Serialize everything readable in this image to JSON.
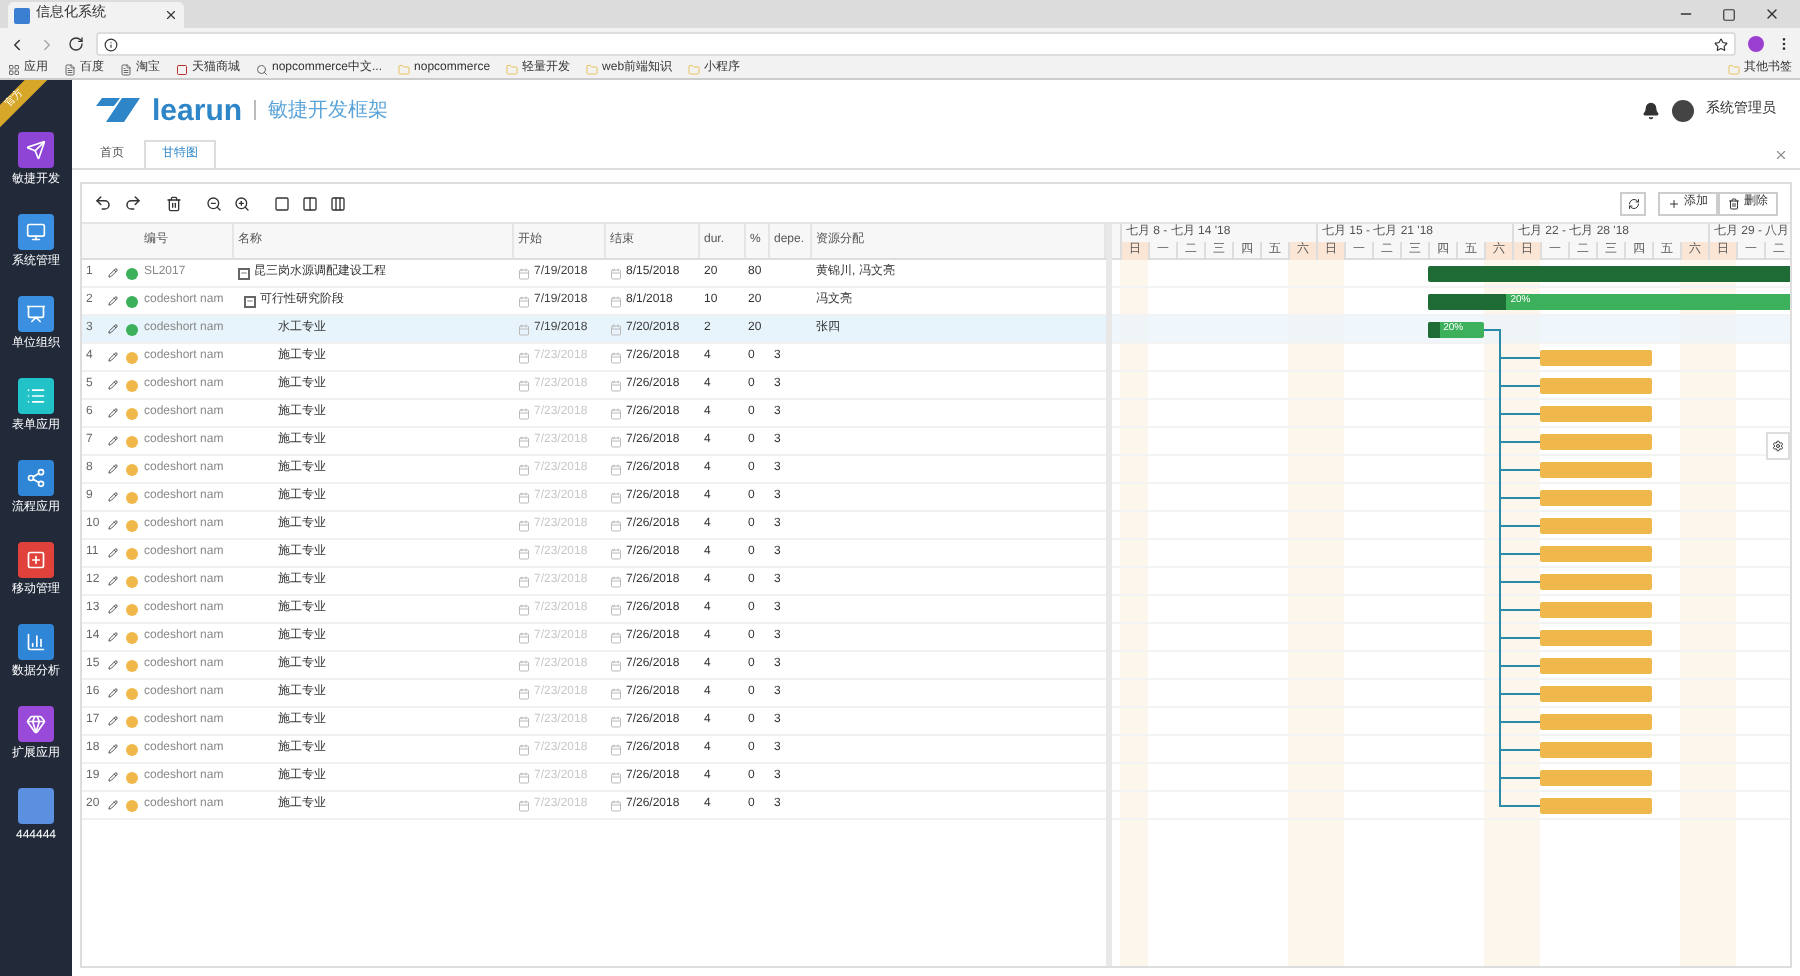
{
  "browser": {
    "tab_title": "信息化系统",
    "bookmarks": [
      {
        "label": "应用",
        "kind": "apps"
      },
      {
        "label": "百度",
        "kind": "page"
      },
      {
        "label": "淘宝",
        "kind": "page"
      },
      {
        "label": "天猫商城",
        "kind": "shop"
      },
      {
        "label": "nopcommerce中文...",
        "kind": "search"
      },
      {
        "label": "nopcommerce",
        "kind": "folder"
      },
      {
        "label": "轻量开发",
        "kind": "folder"
      },
      {
        "label": "web前端知识",
        "kind": "folder"
      },
      {
        "label": "小程序",
        "kind": "folder"
      }
    ],
    "other_bookmarks": "其他书签"
  },
  "sidebar": {
    "ribbon": "官方",
    "items": [
      {
        "label": "敏捷开发",
        "color": "#8e44d4",
        "kind": "send"
      },
      {
        "label": "系统管理",
        "color": "#3b8fe0",
        "kind": "monitor"
      },
      {
        "label": "单位组织",
        "color": "#3b8fe0",
        "kind": "board"
      },
      {
        "label": "表单应用",
        "color": "#22c3c8",
        "kind": "list"
      },
      {
        "label": "流程应用",
        "color": "#2f86d6",
        "kind": "share"
      },
      {
        "label": "移动管理",
        "color": "#e0413b",
        "kind": "plus"
      },
      {
        "label": "数据分析",
        "color": "#2f86d6",
        "kind": "chart"
      },
      {
        "label": "扩展应用",
        "color": "#9a4ad8",
        "kind": "gem"
      },
      {
        "label": "444444",
        "color": "#5b8fe0",
        "kind": "blank"
      }
    ]
  },
  "header": {
    "logo": "learun",
    "subtitle": "敏捷开发框架",
    "user": "系统管理员"
  },
  "tabs": [
    {
      "label": "首页",
      "selected": false
    },
    {
      "label": "甘特图",
      "selected": true
    }
  ],
  "toolbar": {
    "buttons": [
      {
        "label": "添加",
        "kind": "add"
      },
      {
        "label": "删除",
        "kind": "delete"
      }
    ]
  },
  "grid": {
    "columns": [
      "编号",
      "名称",
      "开始",
      "结束",
      "dur.",
      "%",
      "depe.",
      "资源分配"
    ],
    "rows": [
      {
        "num": "1",
        "code": "SL2017",
        "color": "#3cb05a",
        "name": "昆三岗水源调配建设工程",
        "start": "7/19/2018",
        "start_disabled": false,
        "end": "8/15/2018",
        "dur": "20",
        "pct": "80",
        "resource": "黄锦川, 冯文亮",
        "selected": false,
        "expanded": true,
        "kind": "project",
        "children": [
          {
            "num": "2",
            "code": "codeshort nam",
            "color": "#3cb05a",
            "name": "可行性研究阶段",
            "start": "7/19/2018",
            "start_disabled": false,
            "end": "8/1/2018",
            "dur": "10",
            "pct": "20",
            "resource": "冯文亮",
            "selected": false,
            "expanded": true,
            "kind": "task",
            "bar_label": "20%",
            "children": [
              {
                "num": "3",
                "code": "codeshort nam",
                "color": "#3cb05a",
                "name": "水工专业",
                "start": "7/19/2018",
                "start_disabled": false,
                "end": "7/20/2018",
                "dur": "2",
                "pct": "20",
                "resource": "张四",
                "selected": true,
                "kind": "task",
                "bar_label": "20%"
              },
              {
                "num": "4",
                "code": "codeshort nam",
                "color": "#f0b84a",
                "name": "施工专业",
                "start": "7/23/2018",
                "start_disabled": true,
                "end": "7/26/2018",
                "dur": "4",
                "pct": "0",
                "depe": "3",
                "selected": false,
                "kind": "task"
              },
              {
                "num": "5",
                "code": "codeshort nam",
                "color": "#f0b84a",
                "name": "施工专业",
                "start": "7/23/2018",
                "start_disabled": true,
                "end": "7/26/2018",
                "dur": "4",
                "pct": "0",
                "depe": "3",
                "selected": false,
                "kind": "task"
              },
              {
                "num": "6",
                "code": "codeshort nam",
                "color": "#f0b84a",
                "name": "施工专业",
                "start": "7/23/2018",
                "start_disabled": true,
                "end": "7/26/2018",
                "dur": "4",
                "pct": "0",
                "depe": "3",
                "selected": false,
                "kind": "task"
              },
              {
                "num": "7",
                "code": "codeshort nam",
                "color": "#f0b84a",
                "name": "施工专业",
                "start": "7/23/2018",
                "start_disabled": true,
                "end": "7/26/2018",
                "dur": "4",
                "pct": "0",
                "depe": "3",
                "selected": false,
                "kind": "task"
              },
              {
                "num": "8",
                "code": "codeshort nam",
                "color": "#f0b84a",
                "name": "施工专业",
                "start": "7/23/2018",
                "start_disabled": true,
                "end": "7/26/2018",
                "dur": "4",
                "pct": "0",
                "depe": "3",
                "selected": false,
                "kind": "task"
              },
              {
                "num": "9",
                "code": "codeshort nam",
                "color": "#f0b84a",
                "name": "施工专业",
                "start": "7/23/2018",
                "start_disabled": true,
                "end": "7/26/2018",
                "dur": "4",
                "pct": "0",
                "depe": "3",
                "selected": false,
                "kind": "task"
              },
              {
                "num": "10",
                "code": "codeshort nam",
                "color": "#f0b84a",
                "name": "施工专业",
                "start": "7/23/2018",
                "start_disabled": true,
                "end": "7/26/2018",
                "dur": "4",
                "pct": "0",
                "depe": "3",
                "selected": false,
                "kind": "task"
              },
              {
                "num": "11",
                "code": "codeshort nam",
                "color": "#f0b84a",
                "name": "施工专业",
                "start": "7/23/2018",
                "start_disabled": true,
                "end": "7/26/2018",
                "dur": "4",
                "pct": "0",
                "depe": "3",
                "selected": false,
                "kind": "task"
              },
              {
                "num": "12",
                "code": "codeshort nam",
                "color": "#f0b84a",
                "name": "施工专业",
                "start": "7/23/2018",
                "start_disabled": true,
                "end": "7/26/2018",
                "dur": "4",
                "pct": "0",
                "depe": "3",
                "selected": false,
                "kind": "task"
              },
              {
                "num": "13",
                "code": "codeshort nam",
                "color": "#f0b84a",
                "name": "施工专业",
                "start": "7/23/2018",
                "start_disabled": true,
                "end": "7/26/2018",
                "dur": "4",
                "pct": "0",
                "depe": "3",
                "selected": false,
                "kind": "task"
              },
              {
                "num": "14",
                "code": "codeshort nam",
                "color": "#f0b84a",
                "name": "施工专业",
                "start": "7/23/2018",
                "start_disabled": true,
                "end": "7/26/2018",
                "dur": "4",
                "pct": "0",
                "depe": "3",
                "selected": false,
                "kind": "task"
              },
              {
                "num": "15",
                "code": "codeshort nam",
                "color": "#f0b84a",
                "name": "施工专业",
                "start": "7/23/2018",
                "start_disabled": true,
                "end": "7/26/2018",
                "dur": "4",
                "pct": "0",
                "depe": "3",
                "selected": false,
                "kind": "task"
              },
              {
                "num": "16",
                "code": "codeshort nam",
                "color": "#f0b84a",
                "name": "施工专业",
                "start": "7/23/2018",
                "start_disabled": true,
                "end": "7/26/2018",
                "dur": "4",
                "pct": "0",
                "depe": "3",
                "selected": false,
                "kind": "task"
              },
              {
                "num": "17",
                "code": "codeshort nam",
                "color": "#f0b84a",
                "name": "施工专业",
                "start": "7/23/2018",
                "start_disabled": true,
                "end": "7/26/2018",
                "dur": "4",
                "pct": "0",
                "depe": "3",
                "selected": false,
                "kind": "task"
              },
              {
                "num": "18",
                "code": "codeshort nam",
                "color": "#f0b84a",
                "name": "施工专业",
                "start": "7/23/2018",
                "start_disabled": true,
                "end": "7/26/2018",
                "dur": "4",
                "pct": "0",
                "depe": "3",
                "selected": false,
                "kind": "task"
              },
              {
                "num": "19",
                "code": "codeshort nam",
                "color": "#f0b84a",
                "name": "施工专业",
                "start": "7/23/2018",
                "start_disabled": true,
                "end": "7/26/2018",
                "dur": "4",
                "pct": "0",
                "depe": "3",
                "selected": false,
                "kind": "task"
              },
              {
                "num": "20",
                "code": "codeshort nam",
                "color": "#f0b84a",
                "name": "施工专业",
                "start": "7/23/2018",
                "start_disabled": true,
                "end": "7/26/2018",
                "dur": "4",
                "pct": "0",
                "depe": "3",
                "selected": false,
                "kind": "task"
              }
            ]
          }
        ]
      }
    ]
  },
  "timeline": {
    "weeks": [
      "七月 8 - 七月 14 '18",
      "七月 15 - 七月 21 '18",
      "七月 22 - 七月 28 '18",
      "七月 29 - 八月"
    ],
    "days": [
      {
        "label": "日",
        "weekend": true
      },
      {
        "label": "一",
        "weekend": false
      },
      {
        "label": "二",
        "weekend": false
      },
      {
        "label": "三",
        "weekend": false
      },
      {
        "label": "四",
        "weekend": false
      },
      {
        "label": "五",
        "weekend": false
      },
      {
        "label": "六",
        "weekend": true
      },
      {
        "label": "日",
        "weekend": true
      },
      {
        "label": "一",
        "weekend": false
      },
      {
        "label": "二",
        "weekend": false
      },
      {
        "label": "三",
        "weekend": false
      },
      {
        "label": "四",
        "weekend": false
      },
      {
        "label": "五",
        "weekend": false
      },
      {
        "label": "六",
        "weekend": true
      },
      {
        "label": "日",
        "weekend": true
      },
      {
        "label": "一",
        "weekend": false
      },
      {
        "label": "二",
        "weekend": false
      },
      {
        "label": "三",
        "weekend": false
      },
      {
        "label": "四",
        "weekend": false
      },
      {
        "label": "五",
        "weekend": false
      },
      {
        "label": "六",
        "weekend": true
      },
      {
        "label": "日",
        "weekend": true
      },
      {
        "label": "一",
        "weekend": false
      },
      {
        "label": "二",
        "weekend": false
      }
    ]
  }
}
